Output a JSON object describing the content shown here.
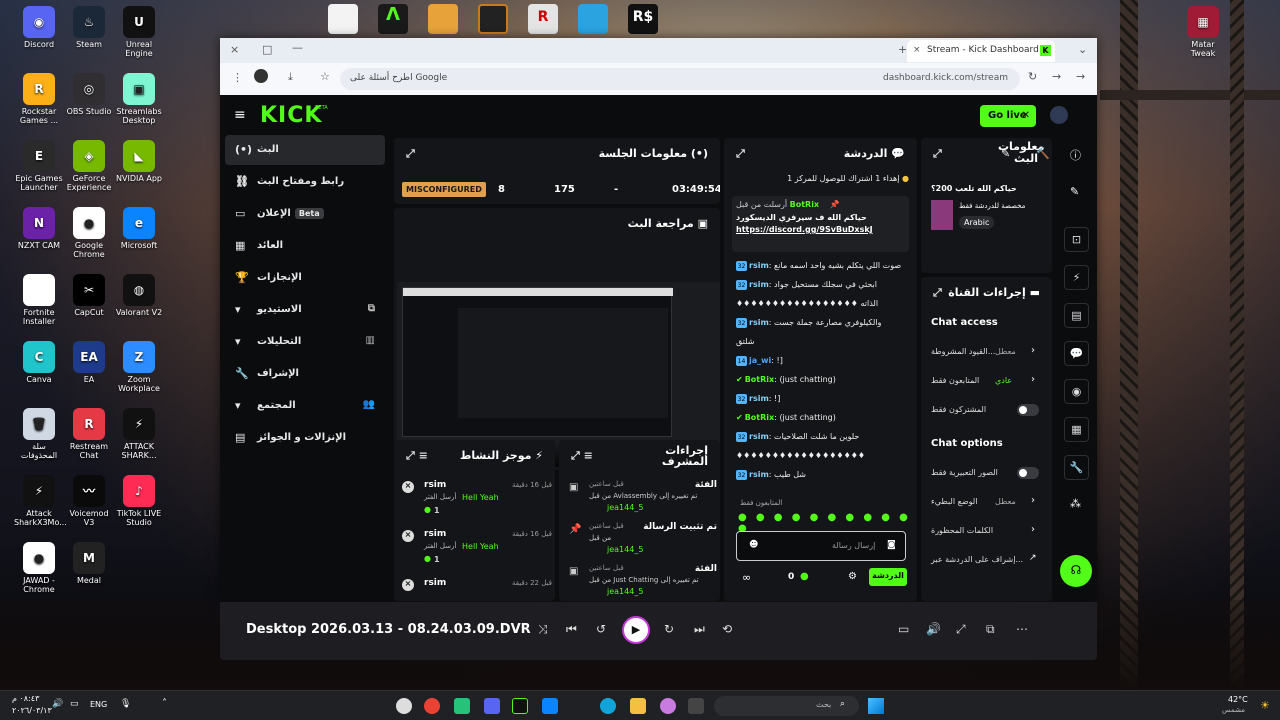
{
  "desktop": {
    "left_icons": [
      {
        "label": "Discord",
        "color": "#5865f2",
        "glyph": "◉"
      },
      {
        "label": "Steam",
        "color": "#1b2838",
        "glyph": "♨"
      },
      {
        "label": "Unreal Engine",
        "color": "#111",
        "glyph": "U"
      },
      {
        "label": "Rockstar Games ...",
        "color": "#fcaf17",
        "glyph": "R"
      },
      {
        "label": "OBS Studio",
        "color": "#302e31",
        "glyph": "◎"
      },
      {
        "label": "Streamlabs Desktop",
        "color": "#80f5d2",
        "glyph": "▣"
      },
      {
        "label": "Epic Games Launcher",
        "color": "#2a2a2a",
        "glyph": "E"
      },
      {
        "label": "GeForce Experience",
        "color": "#76b900",
        "glyph": "◈"
      },
      {
        "label": "NVIDIA App",
        "color": "#76b900",
        "glyph": "◣"
      },
      {
        "label": "NZXT CAM",
        "color": "#6b21a8",
        "glyph": "N"
      },
      {
        "label": "Google Chrome",
        "color": "#ffffff",
        "glyph": "●"
      },
      {
        "label": "Microsoft",
        "color": "#0a84ff",
        "glyph": "e"
      },
      {
        "label": "Fortnite Installer",
        "color": "#ffffff",
        "glyph": ""
      },
      {
        "label": "CapCut",
        "color": "#000",
        "glyph": "✂"
      },
      {
        "label": "Valorant V2",
        "color": "#111",
        "glyph": "◍"
      },
      {
        "label": "Canva",
        "color": "#20c4cb",
        "glyph": "C"
      },
      {
        "label": "EA",
        "color": "#1e3a8a",
        "glyph": "EA"
      },
      {
        "label": "Zoom Workplace",
        "color": "#2d8cff",
        "glyph": "Z"
      },
      {
        "label": "سلة المحذوفات",
        "color": "#cfd8e3",
        "glyph": "🗑"
      },
      {
        "label": "Restream Chat",
        "color": "#e63946",
        "glyph": "R"
      },
      {
        "label": "ATTACK SHARK...",
        "color": "#111",
        "glyph": "⚡"
      },
      {
        "label": "Attack SharkX3Mo...",
        "color": "#111",
        "glyph": "⚡"
      },
      {
        "label": "Voicemod V3",
        "color": "#0a0a0a",
        "glyph": "〰"
      },
      {
        "label": "TikTok LIVE Studio",
        "color": "#fe2c55",
        "glyph": "♪"
      },
      {
        "label": "JAWAD - Chrome",
        "color": "#ffffff",
        "glyph": "●"
      },
      {
        "label": "Medal",
        "color": "#222",
        "glyph": "M"
      }
    ],
    "right_icon": {
      "label": "Matar Tweak",
      "color": "#a01c36",
      "glyph": "▦"
    }
  },
  "browser": {
    "tab_title": "Stream - Kick Dashboard",
    "url": "dashboard.kick.com/stream",
    "search_hint": "اطرح أسئلة على Google",
    "window_buttons": [
      "×",
      "□",
      "—"
    ]
  },
  "kick": {
    "logo": "KICK",
    "logo_beta": "BETA",
    "go_live": "Go live",
    "nav": [
      {
        "label": "البث",
        "icon": "(•)",
        "active": true
      },
      {
        "label": "رابط ومفتاح البث",
        "icon": "⛓",
        "active": false
      },
      {
        "label": "الإعلان",
        "icon": "▭",
        "active": false,
        "beta": "Beta"
      },
      {
        "label": "العائد",
        "icon": "▦",
        "active": false
      },
      {
        "label": "الإنجازات",
        "icon": "🏆",
        "active": false
      },
      {
        "label": "الاستيديو",
        "icon": "▾",
        "active": false,
        "right": "⧉"
      },
      {
        "label": "التحليلات",
        "icon": "▾",
        "active": false,
        "right": "▥"
      },
      {
        "label": "الإشراف",
        "icon": "🔧",
        "active": false
      },
      {
        "label": "المجتمع",
        "icon": "▾",
        "active": false,
        "right": "👥"
      },
      {
        "label": "الإنزالات و الجوائز",
        "icon": "▤",
        "active": false
      }
    ],
    "session": {
      "title": "معلومات الجلسة",
      "status": "MISCONFIGURED",
      "viewers": "8",
      "followers": "175",
      "subs": "-",
      "uptime": "03:49:54"
    },
    "preview": {
      "title": "مراجعة البث"
    },
    "activity": {
      "title": "موجز النشاط",
      "items": [
        {
          "user": "rsim",
          "time": "قبل 16 دقيقة",
          "text": "أرسل الفتر",
          "msg": "Hell Yeah",
          "amount": "1"
        },
        {
          "user": "rsim",
          "time": "قبل 16 دقيقة",
          "text": "أرسل الفتر",
          "msg": "Hell Yeah",
          "amount": "1"
        },
        {
          "user": "rsim",
          "time": "قبل 22 دقيقة",
          "text": "",
          "msg": "",
          "amount": ""
        }
      ]
    },
    "modactions": {
      "title": "إجراءات المشرف",
      "items": [
        {
          "title": "الفئة",
          "time": "قبل ساعتين",
          "line1": "من قبل Avlassembly تم تغييره إلى",
          "line2": "jea144_5"
        },
        {
          "title": "تم تثبيت الرسالة",
          "time": "قبل ساعتين",
          "line1": "من قبل",
          "line2": "jea144_5"
        },
        {
          "title": "الفئة",
          "time": "قبل ساعتين",
          "line1": "من قبل Just Chatting تم تغييره إلى",
          "line2": "jea144_5"
        }
      ]
    },
    "chat": {
      "title": "الدردشة",
      "pinned_banner": "إهداء 1 اشتراك للوصول للمركز 1",
      "pinned_by": "أرسلت من قبل",
      "pinned_user": "BotRix",
      "pinned_text": "حياكم الله ف سيرفري الديسكورد",
      "pinned_link": "https://discord.gg/9SvBuDxskJ",
      "messages": [
        {
          "badge": "32",
          "user": "rsim",
          "color": "#7fd4ff",
          "text": "صوت اللي يتكلم بشيه واحد اسمه مانع"
        },
        {
          "badge": "32",
          "user": "rsim",
          "color": "#7fd4ff",
          "text": "ابحثي في سجلك مستحيل جواد"
        },
        {
          "badge": "",
          "user": "",
          "color": "#ffffff",
          "text": "♦♦♦♦♦♦♦♦♦♦♦♦♦♦♦♦♦ الذاته"
        },
        {
          "badge": "32",
          "user": "rsim",
          "color": "#7fd4ff",
          "text": "والكيلوفري مصارعة جملة جست"
        },
        {
          "badge": "",
          "user": "",
          "color": "#ffffff",
          "text": "شلتق"
        },
        {
          "badge": "14",
          "user": "ja_wi",
          "color": "#53a6ff",
          "text": "!]"
        },
        {
          "badge": "",
          "user": "BotRix",
          "color": "#53fc18",
          "text": "(just chatting)"
        },
        {
          "badge": "32",
          "user": "rsim",
          "color": "#7fd4ff",
          "text": "!]"
        },
        {
          "badge": "",
          "user": "BotRix",
          "color": "#53fc18",
          "text": "(just chatting)"
        },
        {
          "badge": "32",
          "user": "rsim",
          "color": "#7fd4ff",
          "text": "حلوين ما شلت الصلاحيات"
        },
        {
          "badge": "",
          "user": "",
          "color": "#ffffff",
          "text": "♦♦♦♦♦♦♦♦♦♦♦♦♦♦♦♦♦♦"
        },
        {
          "badge": "32",
          "user": "rsim",
          "color": "#7fd4ff",
          "text": "شل طيب"
        }
      ],
      "followers_only": "المتابعون فقط",
      "input_placeholder": "إرسال رسالة",
      "send": "الدردشة",
      "count": "0"
    },
    "stream_info": {
      "title": "معلومات البث",
      "stream_title": "حياكم الله تلعب 200؟",
      "category": "مخصصة للدردشة فقط",
      "tag": "Arabic"
    },
    "channel_actions": {
      "title": "إجراءات القناة",
      "access_title": "Chat access",
      "access": [
        {
          "label": "القيود المشروطة...",
          "value": "معطل"
        },
        {
          "label": "المتابعون فقط",
          "value": "عادي"
        },
        {
          "label": "المشتركون فقط",
          "value": ""
        }
      ],
      "options_title": "Chat options",
      "options": [
        {
          "label": "الصور التعبيرية فقط",
          "value": ""
        },
        {
          "label": "الوضع البطيء",
          "value": "معطل"
        },
        {
          "label": "الكلمات المحظورة",
          "value": ""
        },
        {
          "label": "إشراف على الدردشة عبر...",
          "value": ""
        }
      ]
    }
  },
  "player": {
    "title": "Desktop 2026.03.13 - 08.24.03.09.DVR"
  },
  "taskbar": {
    "time": "٠٨:٤٣ م",
    "date": "٢٠٢٦/٠٣/١٣",
    "lang": "ENG",
    "weather": "42°C",
    "weather_text": "مشمس",
    "search": "بحث"
  },
  "colors": {
    "kick_green": "#53fc18",
    "panel": "#141518",
    "bg": "#0b0c0e"
  }
}
